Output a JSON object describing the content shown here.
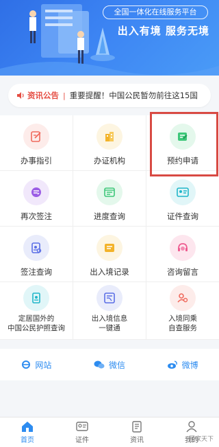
{
  "banner": {
    "platform_tag": "全国一体化在线服务平台",
    "slogan": "出入有境  服务无境"
  },
  "notice": {
    "label": "资讯公告",
    "separator": "|",
    "text": "重要提醒！中国公民暂勿前往这15国",
    "accent_color": "#e54d42"
  },
  "services": [
    {
      "label": "办事指引",
      "icon": "guide-edit-icon",
      "color": "#f06a5d",
      "bg": "#fdecea"
    },
    {
      "label": "办证机构",
      "icon": "building-icon",
      "color": "#f3b32a",
      "bg": "#fdf5e1"
    },
    {
      "label": "预约申请",
      "icon": "appointment-icon",
      "color": "#3ec77a",
      "bg": "#e4f8ec"
    },
    {
      "label": "再次签注",
      "icon": "refresh-visa-icon",
      "color": "#9b5de5",
      "bg": "#f1e8fb"
    },
    {
      "label": "进度查询",
      "icon": "progress-icon",
      "color": "#3ec77a",
      "bg": "#e4f8ec"
    },
    {
      "label": "证件查询",
      "icon": "id-card-icon",
      "color": "#21b6c9",
      "bg": "#e1f6f8"
    },
    {
      "label": "签注查询",
      "icon": "visa-search-icon",
      "color": "#5b6fe6",
      "bg": "#e9ecfb"
    },
    {
      "label": "出入境记录",
      "icon": "record-icon",
      "color": "#f3b32a",
      "bg": "#fdf5e1"
    },
    {
      "label": "咨询留言",
      "icon": "headset-icon",
      "color": "#ee5a8f",
      "bg": "#fde6ee"
    },
    {
      "label": "定居国外的\n中国公民护照查询",
      "icon": "passport-icon",
      "color": "#21b6c9",
      "bg": "#e1f6f8"
    },
    {
      "label": "出入境信息\n一键通",
      "icon": "info-hub-icon",
      "color": "#5b6fe6",
      "bg": "#e9ecfb"
    },
    {
      "label": "入境同乘\n自查服务",
      "icon": "people-search-icon",
      "color": "#f06a5d",
      "bg": "#fdecea"
    }
  ],
  "links": [
    {
      "label": "网站",
      "icon": "ie-browser-icon"
    },
    {
      "label": "微信",
      "icon": "wechat-icon"
    },
    {
      "label": "微博",
      "icon": "weibo-icon"
    }
  ],
  "tabs": [
    {
      "label": "首页",
      "icon": "home-icon",
      "active": true
    },
    {
      "label": "证件",
      "icon": "card-icon",
      "active": false
    },
    {
      "label": "资讯",
      "icon": "news-icon",
      "active": false
    },
    {
      "label": "我的",
      "icon": "user-icon",
      "active": false
    }
  ],
  "watermark": "国家天下",
  "accent": "#2d8cf0",
  "highlight_color": "#d84a43"
}
